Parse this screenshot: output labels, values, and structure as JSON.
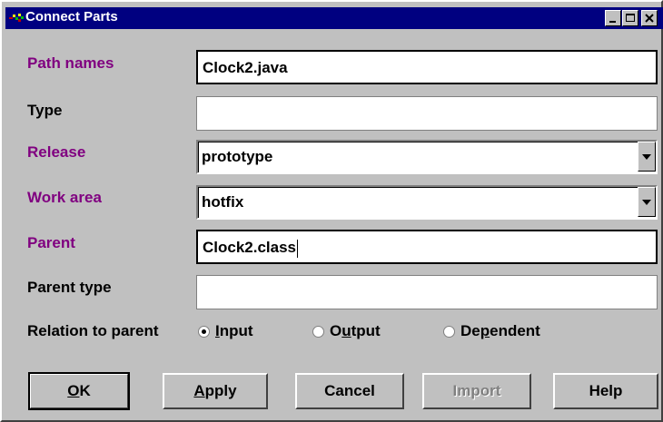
{
  "window": {
    "title": "Connect Parts"
  },
  "fields": {
    "path_names": {
      "label": "Path names",
      "value": "Clock2.java"
    },
    "type": {
      "label": "Type",
      "value": ""
    },
    "release": {
      "label": "Release",
      "value": "prototype"
    },
    "work_area": {
      "label": "Work area",
      "value": "hotfix"
    },
    "parent": {
      "label": "Parent",
      "value": "Clock2.class"
    },
    "parent_type": {
      "label": "Parent type",
      "value": ""
    }
  },
  "relation": {
    "label": "Relation to parent",
    "options": [
      {
        "pre": "",
        "ul": "I",
        "post": "nput",
        "selected": true
      },
      {
        "pre": "O",
        "ul": "u",
        "post": "tput",
        "selected": false
      },
      {
        "pre": "De",
        "ul": "p",
        "post": "endent",
        "selected": false
      }
    ]
  },
  "buttons": {
    "ok": {
      "pre": "",
      "ul": "O",
      "post": "K"
    },
    "apply": {
      "pre": "",
      "ul": "A",
      "post": "pply"
    },
    "cancel": "Cancel",
    "import": "Import",
    "help": "Help"
  },
  "colors": {
    "titlebar": "#000080",
    "required_label": "#800080",
    "face": "#c0c0c0"
  }
}
